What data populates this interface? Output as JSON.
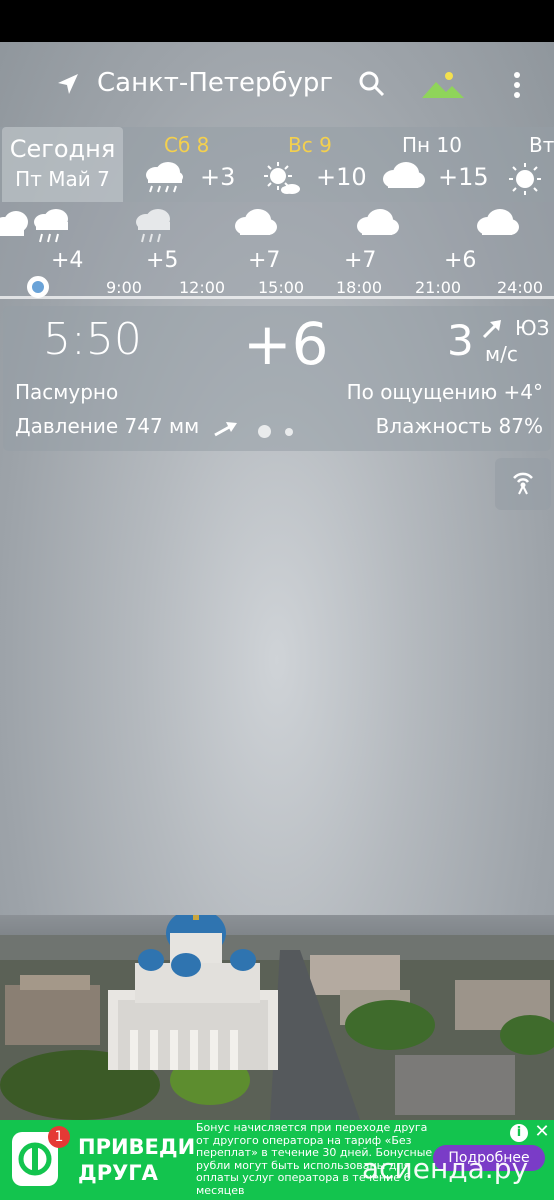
{
  "header": {
    "city": "Санкт-Петербург",
    "icons": [
      "navigation-arrow-icon",
      "search-icon",
      "landscape-icon",
      "more-vert-icon"
    ]
  },
  "days": {
    "today": {
      "label": "Сегодня",
      "date": "Пт Май 7"
    },
    "items": [
      {
        "name": "Сб 8",
        "temp": "+3",
        "icon": "rain-icon",
        "weekend": true
      },
      {
        "name": "Вс 9",
        "temp": "+10",
        "icon": "sun-cloud-icon",
        "weekend": true
      },
      {
        "name": "Пн 10",
        "temp": "+15",
        "icon": "cloud-icon",
        "weekend": false
      },
      {
        "name": "Вт",
        "temp": "",
        "icon": "sun-icon",
        "weekend": false
      }
    ]
  },
  "hourly": {
    "temps": [
      "+4",
      "+5",
      "+7",
      "+7",
      "+6"
    ],
    "times": [
      "9:00",
      "12:00",
      "15:00",
      "18:00",
      "21:00",
      "24:00"
    ]
  },
  "current": {
    "time": "5:50",
    "temp": "+6",
    "wind_speed": "3",
    "wind_dir": "ЮЗ",
    "wind_unit": "м/с",
    "condition": "Пасмурно",
    "feels_like": "По ощущению +4°",
    "pressure": "Давление 747 мм",
    "humidity": "Влажность 87%"
  },
  "ad": {
    "badge": "1",
    "title": "ПРИВЕДИ ДРУГА",
    "text": "Бонус начисляется при переходе друга от другого оператора на тариф «Без переплат» в течение 30 дней. Бонусные рубли могут быть использованы для оплаты услуг оператора в течение 6 месяцев",
    "cta": "Подробнее",
    "info": "i",
    "close": "✕",
    "watermark": "асиенда.ру"
  },
  "colors": {
    "weekend": "#f4d04e",
    "ad_bg": "#13c44e",
    "ad_cta": "#7a3cc7",
    "slider": "#6aa3d8"
  }
}
